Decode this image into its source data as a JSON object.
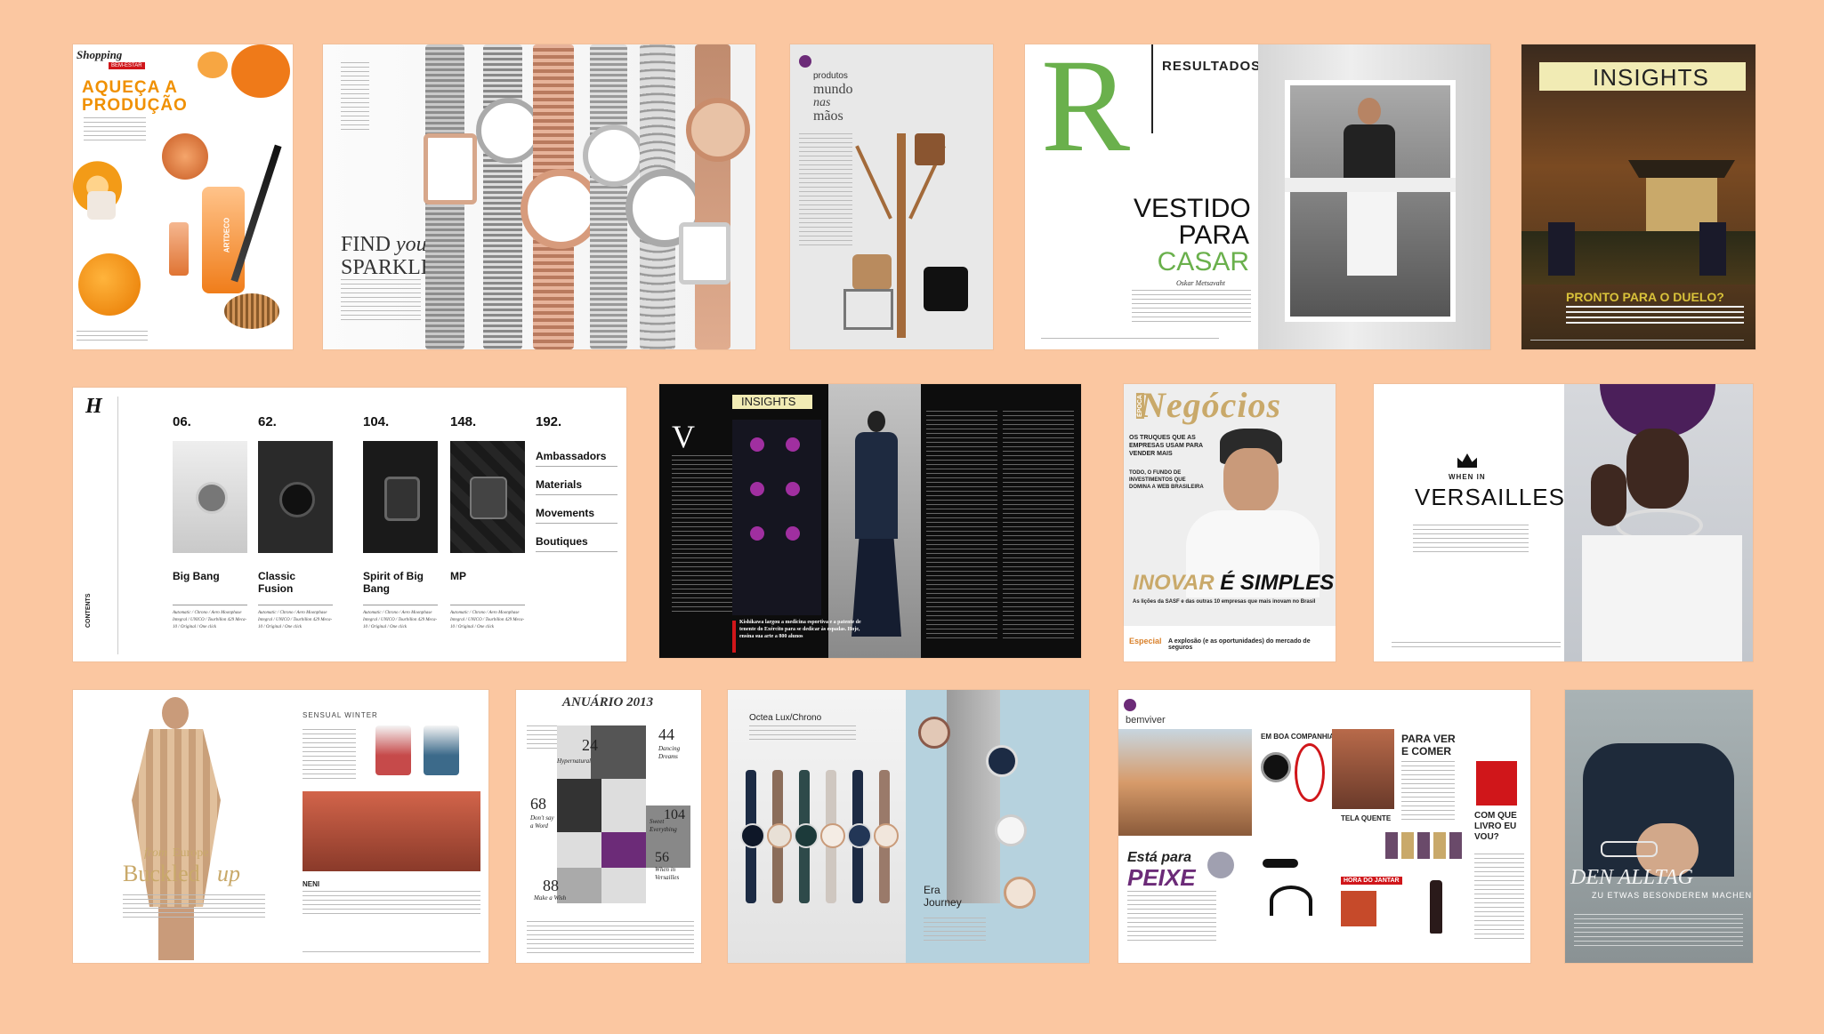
{
  "p1": {
    "brand": "Shopping",
    "tag": "BEM-ESTAR",
    "headline1": "AQUEÇA A",
    "headline2": "PRODUÇÃO",
    "bottle_label": "ARTDECO"
  },
  "p2": {
    "headline1": "FIND",
    "headline_italic": "your",
    "headline2": "SPARKLE"
  },
  "p3": {
    "section": "produtos",
    "title_line1": "mundo",
    "title_line2": "nas",
    "title_line3": "mãos"
  },
  "p4": {
    "big_letter": "R",
    "section": "RESULTADOS",
    "title_line1_a": "VESTI",
    "title_line1_b": "DO",
    "title_line2": "PARA",
    "title_line3": "CASAR",
    "intro_name": "Oskar Metsavaht"
  },
  "p5": {
    "label": "INSIGHTS",
    "headline": "PRONTO PARA O DUELO?"
  },
  "p6": {
    "logo": "H",
    "side_label": "CONTENTS",
    "columns": [
      {
        "num": "06.",
        "name": "Big Bang",
        "sub": "Automatic / Chrono / Aero Moonphase Integral / UNICO / Tourbillon 429 Meca-10 / Original / One click"
      },
      {
        "num": "62.",
        "name": "Classic Fusion",
        "sub": "Automatic / Chrono / Aero Moonphase Integral / UNICO / Tourbillon 429 Meca-10 / Original / One click"
      },
      {
        "num": "104.",
        "name": "Spirit of Big Bang",
        "sub": "Automatic / Chrono / Aero Moonphase Integral / UNICO / Tourbillon 429 Meca-10 / Original / One click"
      },
      {
        "num": "148.",
        "name": "MP",
        "sub": "Automatic / Chrono / Aero Moonphase Integral / UNICO / Tourbillon 429 Meca-10 / Original / One click"
      }
    ],
    "last_num": "192.",
    "links": [
      "Ambassadors",
      "Materials",
      "Movements",
      "Boutiques"
    ]
  },
  "p7": {
    "label": "INSIGHTS",
    "dropcap": "V",
    "pullquote": "Kishikawa largou a medicina esportiva e a patente de tenente do Exército para se dedicar às espadas. Hoje, ensina sua arte a 800 alunos"
  },
  "p8": {
    "masthead": "Negócios",
    "tag": "ÉPOCA",
    "headline_a": "INOVAR",
    "headline_b": "É SIMPLES",
    "subhead": "As lições da SASF e das outras 10 empresas que mais inovam no Brasil",
    "special_label": "Especial",
    "special_text": "A explosão (e as oportunidades) do mercado de seguros",
    "teaser1": "OS TRUQUES QUE AS EMPRESAS USAM PARA VENDER MAIS",
    "teaser2": "TODO, O FUNDO DE INVESTIMENTOS QUE DOMINA A WEB BRASILEIRA"
  },
  "p9": {
    "small": "WHEN IN",
    "title": "VERSAILLES"
  },
  "p10": {
    "section": "SENSUAL WINTER",
    "title_italic_a": "from",
    "title_roman": "Europe",
    "title_line2_a": "Buckled",
    "title_line2_b": "up",
    "footer_name": "NENI"
  },
  "p11": {
    "title": "ANUÁRIO 2013",
    "items": [
      {
        "num": "24",
        "label": "Hypernatural"
      },
      {
        "num": "44",
        "label": "Dancing Dreams"
      },
      {
        "num": "68",
        "label": "Don't say a Word"
      },
      {
        "num": "104",
        "label": "Sweet Everything"
      },
      {
        "num": "56",
        "label": "When in Versailles"
      },
      {
        "num": "88",
        "label": "Make a Wish"
      }
    ]
  },
  "p12": {
    "title": "Octea Lux/Chrono",
    "era_title": "Era Journey"
  },
  "p13": {
    "section": "bemviver",
    "headline_a": "Está para",
    "headline_b": "PEIXE",
    "col1": "EM BOA COMPANHIA",
    "col2": "PARA VER E COMER",
    "col3": "TELA QUENTE",
    "col4": "HORA DO JANTAR",
    "col5": "COM QUE LIVRO EU VOU?"
  },
  "p14": {
    "headline": "DEN ALLTAG",
    "subhead": "ZU ETWAS BESONDEREM MACHEN"
  },
  "colors": {
    "background": "#fbc7a1",
    "green": "#6ab04c",
    "red": "#d0161a",
    "gold": "#c9a96a",
    "purple": "#6c2b78"
  }
}
